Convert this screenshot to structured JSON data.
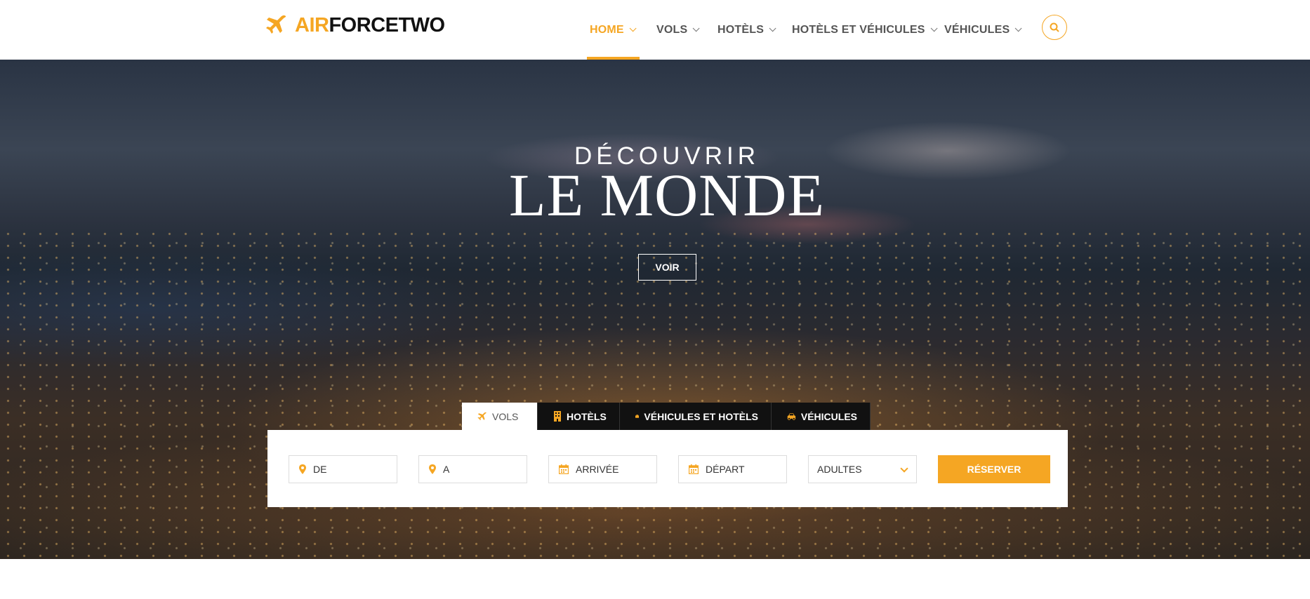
{
  "brand": {
    "accent": "#f5a623",
    "part1": "AIR",
    "part2": "FORCETWO"
  },
  "nav": {
    "items": [
      {
        "label": "HOME",
        "active": true
      },
      {
        "label": "VOLS"
      },
      {
        "label": "HOTÈLS"
      },
      {
        "label": "HOTÈLS ET VÉHICULES"
      },
      {
        "label": "VÉHICULES"
      }
    ],
    "search_icon": "search-icon"
  },
  "hero": {
    "subtitle": "DÉCOUVRIR",
    "title": "LE MONDE",
    "button": "VOIR"
  },
  "booking": {
    "tabs": [
      {
        "label": "VOLS",
        "icon": "plane-icon",
        "active": true
      },
      {
        "label": "HOTÈLS",
        "icon": "hotel-icon"
      },
      {
        "label": "VÉHICULES ET HOTÈLS",
        "icon": "suitcase-icon"
      },
      {
        "label": "VÉHICULES",
        "icon": "car-icon"
      }
    ],
    "fields": {
      "from": "DE",
      "to": "A",
      "arrival": "ARRIVÉE",
      "departure": "DÉPART",
      "adults": "ADULTES"
    },
    "submit": "RÉSERVER"
  }
}
